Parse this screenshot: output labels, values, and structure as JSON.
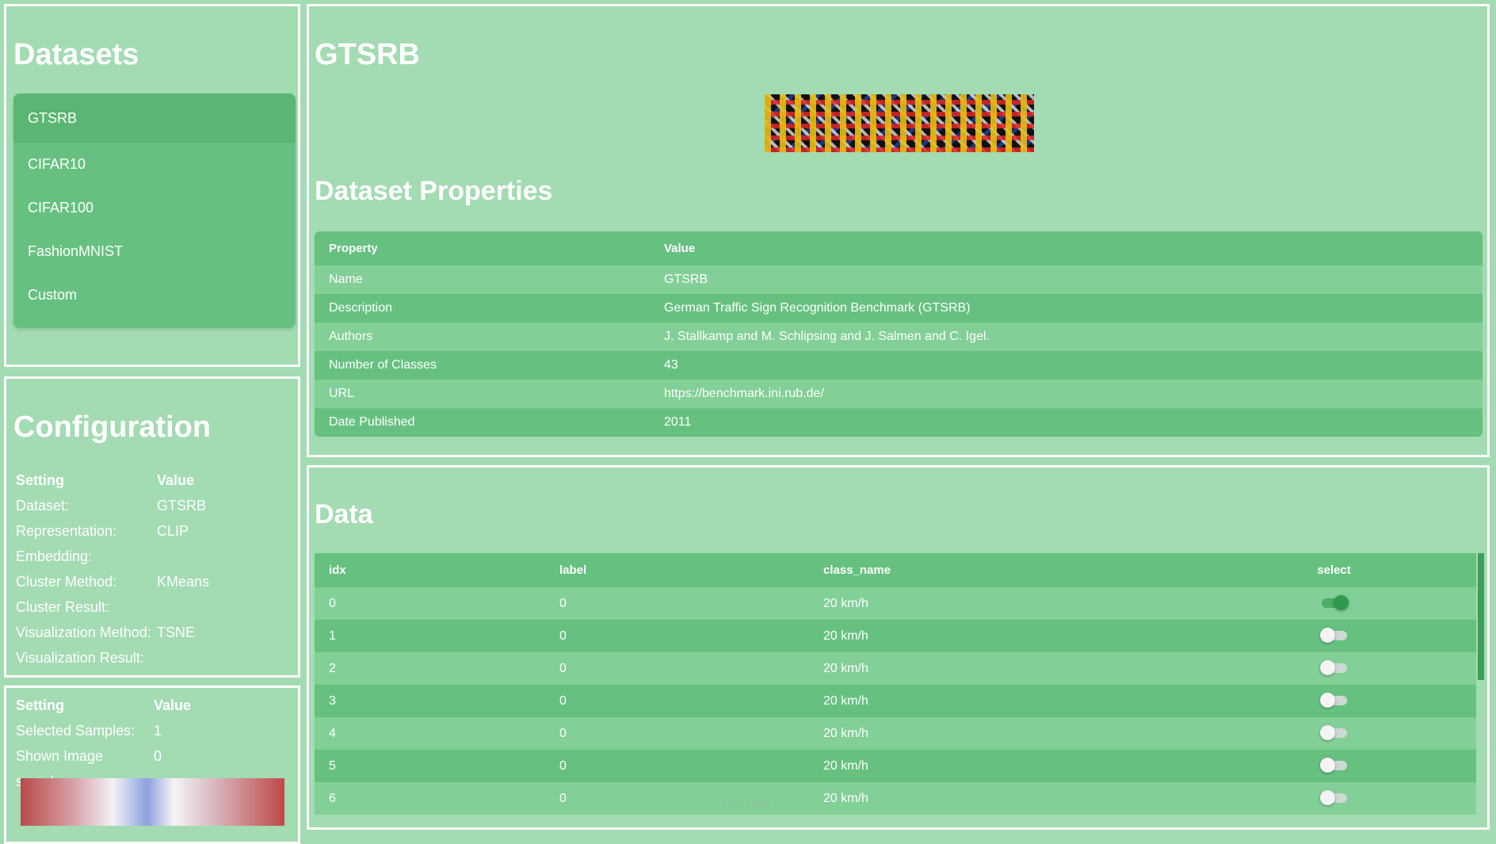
{
  "datasets": {
    "title": "Datasets",
    "items": [
      {
        "label": "GTSRB",
        "active": true
      },
      {
        "label": "CIFAR10"
      },
      {
        "label": "CIFAR100"
      },
      {
        "label": "FashionMNIST"
      },
      {
        "label": "Custom"
      }
    ]
  },
  "configuration": {
    "title": "Configuration",
    "header": {
      "setting": "Setting",
      "value": "Value"
    },
    "rows": [
      {
        "k": "Dataset:",
        "v": "GTSRB"
      },
      {
        "k": "Representation:",
        "v": "CLIP"
      },
      {
        "k": "Embedding:",
        "v": ""
      },
      {
        "k": "Cluster Method:",
        "v": "KMeans"
      },
      {
        "k": "Cluster Result:",
        "v": ""
      },
      {
        "k": "Visualization Method:",
        "v": "TSNE"
      },
      {
        "k": "Visualization Result:",
        "v": ""
      }
    ]
  },
  "selection": {
    "header": {
      "setting": "Setting",
      "value": "Value"
    },
    "rows": [
      {
        "k": "Selected Samples:",
        "v": "1"
      },
      {
        "k": "Shown Image sample:",
        "v": "0"
      }
    ]
  },
  "dataset_view": {
    "title": "GTSRB",
    "properties_title": "Dataset Properties",
    "columns": [
      "Property",
      "Value"
    ],
    "rows": [
      {
        "k": "Name",
        "v": "GTSRB"
      },
      {
        "k": "Description",
        "v": "German Traffic Sign Recognition Benchmark (GTSRB)"
      },
      {
        "k": "Authors",
        "v": "J. Stallkamp and M. Schlipsing and J. Salmen and C. Igel."
      },
      {
        "k": "Number of Classes",
        "v": "43"
      },
      {
        "k": "URL",
        "v": "https://benchmark.ini.rub.de/"
      },
      {
        "k": "Date Published",
        "v": "2011"
      }
    ]
  },
  "data": {
    "title": "Data",
    "columns": [
      "idx",
      "label",
      "class_name",
      "select"
    ],
    "rows": [
      {
        "idx": "0",
        "label": "0",
        "class_name": "20 km/h",
        "selected": true
      },
      {
        "idx": "1",
        "label": "0",
        "class_name": "20 km/h",
        "selected": false
      },
      {
        "idx": "2",
        "label": "0",
        "class_name": "20 km/h",
        "selected": false
      },
      {
        "idx": "3",
        "label": "0",
        "class_name": "20 km/h",
        "selected": false
      },
      {
        "idx": "4",
        "label": "0",
        "class_name": "20 km/h",
        "selected": false
      },
      {
        "idx": "5",
        "label": "0",
        "class_name": "20 km/h",
        "selected": false
      },
      {
        "idx": "6",
        "label": "0",
        "class_name": "20 km/h",
        "selected": false
      }
    ]
  },
  "watermark": "Talpy inside",
  "colors": {
    "background": "#a3dbb3",
    "row_dark": "#66c180",
    "row_light": "#82cf97",
    "toggle_on": "#2f9a4e"
  }
}
